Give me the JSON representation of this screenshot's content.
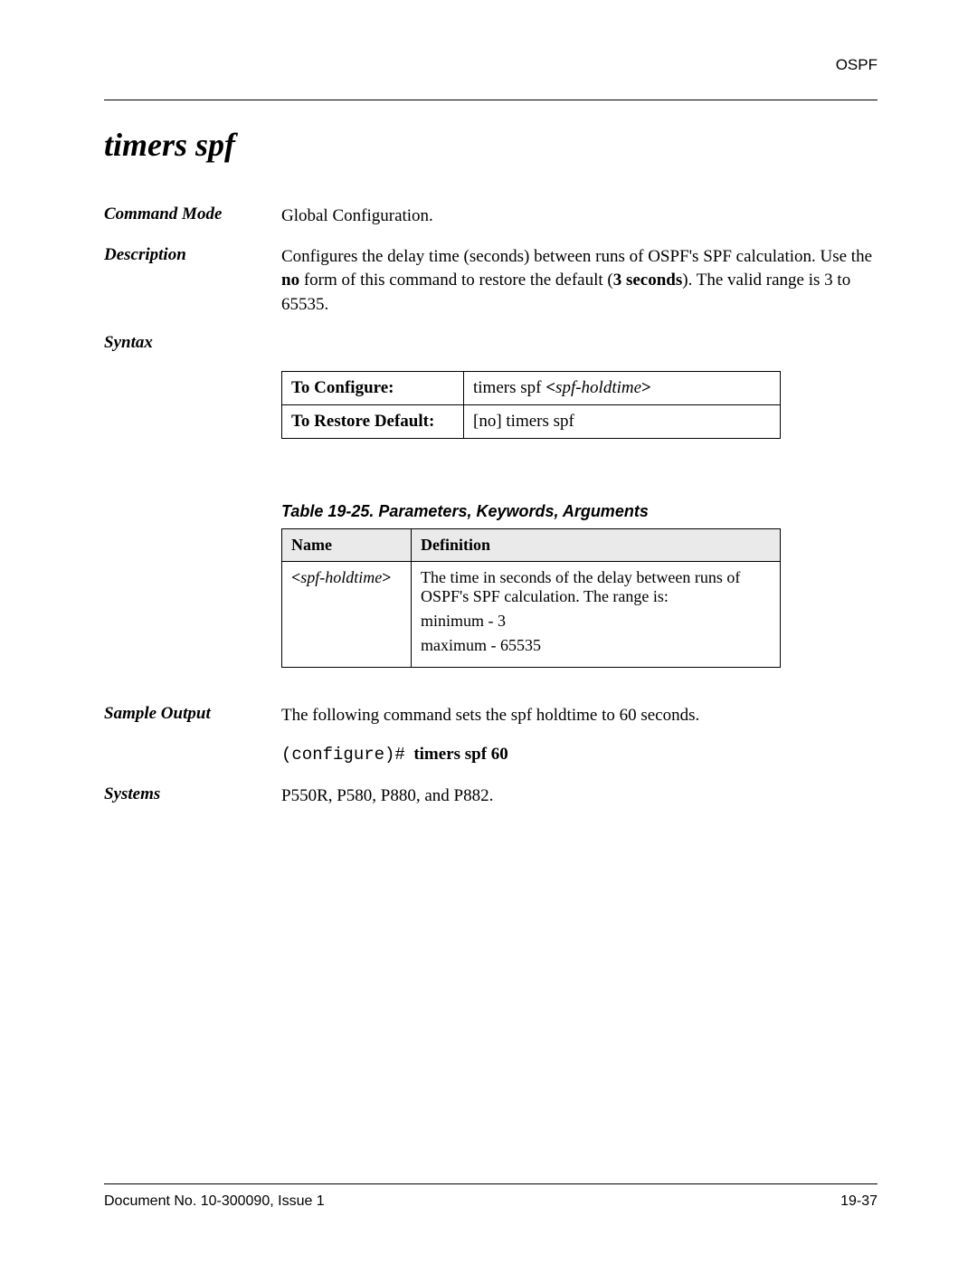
{
  "header": {
    "category": "OSPF"
  },
  "title": "timers spf",
  "command_mode": {
    "label": "Command Mode",
    "value": "Global Configuration."
  },
  "description": {
    "label": "Description",
    "text_pre": "Configures the delay time (seconds) between runs of OSPF's SPF calculation. Use the ",
    "no_word": "no",
    "text_mid": " form of this command to restore the default (",
    "default_value": "3 seconds",
    "text_post": "). The valid range is 3 to 65535."
  },
  "syntax": {
    "label": "Syntax",
    "rows": {
      "configure": {
        "label": "To Configure:",
        "cmd_prefix": "timers spf ",
        "angle_open": "<",
        "param": "spf-holdtime",
        "angle_close": ">"
      },
      "restore": {
        "label": "To Restore Default:",
        "cmd": "[no] timers spf"
      }
    }
  },
  "table_caption": "Table 19-25.  Parameters, Keywords, Arguments",
  "param_table": {
    "headers": {
      "name": "Name",
      "definition": "Definition"
    },
    "row": {
      "angle_open": "<",
      "name": "spf-holdtime",
      "angle_close": ">",
      "def_line1": "The time in seconds of the delay between runs of OSPF's SPF calculation. The range is:",
      "def_line2": "minimum - 3",
      "def_line3": "maximum - 65535"
    }
  },
  "sample_output": {
    "label": "Sample Output",
    "text": "The following command sets the spf holdtime to 60 seconds.",
    "prompt": "(configure)#",
    "command": "timers spf 60"
  },
  "systems": {
    "label": "Systems",
    "value": "P550R, P580, P880, and P882."
  },
  "footer": {
    "doc": "Document No. 10-300090, Issue 1",
    "page": "19-37"
  }
}
